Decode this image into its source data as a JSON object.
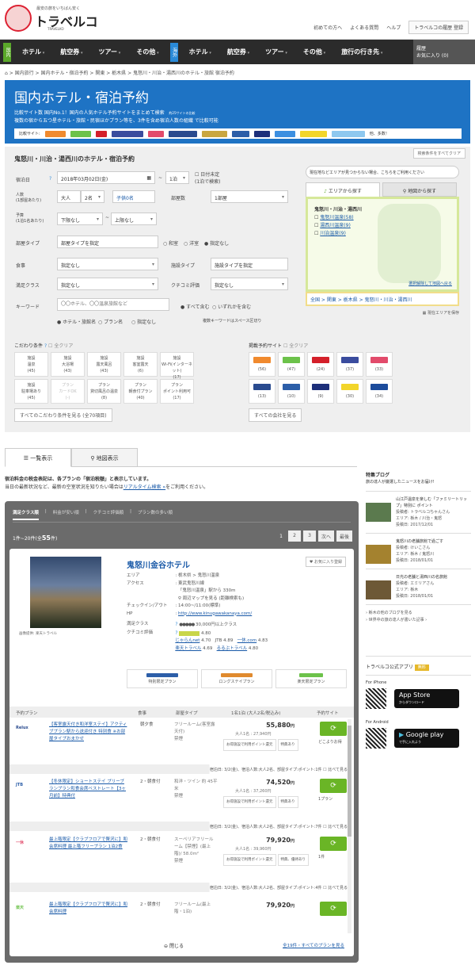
{
  "header": {
    "logo": "トラベルコ",
    "logo_tagline": "最安の旅をいちばん安く",
    "logo_sub": "TRAVELKO",
    "links": [
      "初めての方へ",
      "よくある質問",
      "ヘルプ"
    ],
    "history_button": "トラベルコの履歴 登録"
  },
  "nav": {
    "domestic_tag": "国内",
    "overseas_tag": "海外",
    "domestic": [
      "ホテル",
      "航空券",
      "ツアー",
      "その他"
    ],
    "overseas": [
      "ホテル",
      "航空券",
      "ツアー",
      "その他",
      "旅行の行き先"
    ],
    "history": "履歴",
    "favorites": "お気に入り (0)"
  },
  "breadcrumb": "⌂ > 国内旅行 > 国内ホテル・宿泊予約 > 関東 > 栃木県 > 鬼怒川・川治・湯西川のホテル・旅館 宿泊予約",
  "banner": {
    "title": "国内ホテル・宿泊予約",
    "line1": "比較サイト数 国内No.1！国内の人気ホテル予約サイトをまとめて検索",
    "line1_note": "約25サイトの比較",
    "line2": "複数の宿から五つ星ホテル・旅館・民宿ほかプラン等を、3件を含め宿泊人数の組織 で比較可能",
    "sites_label": "比較サイト:",
    "sites_more": "他、多数！"
  },
  "search": {
    "title": "鬼怒川・川治・湯西川のホテル・宿泊予約",
    "clear": "検索条件をすべてクリア",
    "date_label": "宿泊日",
    "date": "2018年03月02日(金)",
    "nights": "1泊",
    "undecided": "日付未定",
    "undecided_note": "(1泊で検索)",
    "people_label": "人数",
    "people_sub": "(1部屋あたり)",
    "adult": "大人",
    "adult_count": "2名",
    "children": "子供0名",
    "rooms_label": "部屋数",
    "rooms": "1部屋",
    "budget_label": "予算",
    "budget_sub": "(1泊1名あたり)",
    "budget_min": "下限なし",
    "budget_max": "上限なし",
    "roomtype_label": "部屋タイプ",
    "roomtype": "部屋タイプを指定",
    "room_opts": [
      "和室",
      "洋室",
      "指定なし"
    ],
    "meal_label": "食事",
    "meal": "指定なし",
    "facility_label": "施設タイプ",
    "facility": "施設タイプを指定",
    "class_label": "満足クラス",
    "class": "指定なし",
    "rating_label": "クチコミ評価",
    "rating": "指定なし",
    "keyword_label": "キーワード",
    "keyword_placeholder": "〇〇ホテル、〇〇温泉旅館など",
    "kw_opts": [
      "すべて含む",
      "いずれかを含む"
    ],
    "target_opts": [
      "ホテル・旅館名",
      "プラン名",
      "指定なし"
    ],
    "kw_note": "複数キーワードはスペース区切り",
    "area_hint": "現在地などエリアが見つからない場合、こちらをご利用ください",
    "area_tab": "エリアから探す",
    "map_tab": "地図から探す",
    "area_title": "鬼怒川・川治・湯西川",
    "areas": [
      "鬼怒川温泉(58)",
      "湯西川温泉(9)",
      "川治温泉(9)"
    ],
    "area_back": "選択解除して地図へ戻る",
    "area_path": "全国 > 関東 > 栃木県 > 鬼怒川・川治・湯西川",
    "area_save": "現在エリアを保存"
  },
  "conditions": {
    "title": "こだわり条件",
    "clear": "全クリア",
    "items": [
      [
        "施設",
        "温泉",
        "(45)"
      ],
      [
        "施設",
        "大浴場",
        "(43)"
      ],
      [
        "施設",
        "露天風呂",
        "(43)"
      ],
      [
        "施設",
        "客室露天",
        "(6)"
      ],
      [
        "施設",
        "Wi-Fi(インターネット)",
        "(17)"
      ],
      [
        "施設",
        "駐車場あり",
        "(45)"
      ],
      [
        "プラン",
        "カードOK",
        "(-)"
      ],
      [
        "プラン",
        "貸切風呂の温泉",
        "(8)"
      ],
      [
        "プラン",
        "朝食付プラン",
        "(40)"
      ],
      [
        "プラン",
        "ポイント利用可",
        "(17)"
      ]
    ],
    "more": "すべてのこだわり条件を見る (全70項目)"
  },
  "sites": {
    "title": "掲載予約サイト",
    "clear": "全クリア",
    "items": [
      [
        "jalan",
        "#f08a2e",
        "(56)"
      ],
      [
        "楽天",
        "#6cc24a",
        "(47)"
      ],
      [
        "JTB",
        "#d4202a",
        "(24)"
      ],
      [
        "るるぶ",
        "#3a4c9e",
        "(37)"
      ],
      [
        "一休",
        "#e24b6b",
        "(33)"
      ],
      [
        "Relux",
        "#2a4b8f",
        "(13)"
      ],
      [
        "JAL",
        "#2c5ea8",
        "(10)"
      ],
      [
        "ANA",
        "#1d2f7a",
        "(9)"
      ],
      [
        "Yahoo",
        "#f2d52a",
        "(30)"
      ],
      [
        "Booking",
        "#1c4c9c",
        "(34)"
      ]
    ],
    "more": "すべての会社を見る"
  },
  "view_tabs": [
    "一覧表示",
    "地図表示"
  ],
  "notice": {
    "line1": "宿泊料金の税金表記は、各プランの「宿泊税額」と表示しています。",
    "line2": "当日の最新状況など、最新の空室状況を知りたい場合は",
    "link": "リアルタイム検索 »",
    "line2_end": "をご利用ください。"
  },
  "results": {
    "sorts": [
      "満足クラス順",
      "料金が安い順",
      "クチコミ評価順",
      "プラン数の多い順"
    ],
    "count_prefix": "1件~20件(全",
    "count": "55",
    "count_suffix": "件)",
    "pages": [
      "1",
      "2",
      "3",
      "次へ",
      "最後"
    ],
    "hotel": {
      "name": "鬼怒川金谷ホテル",
      "favorite": "お気に入り登録",
      "photo_credit": "画像提供: 楽天トラベル",
      "area_label": "エリア",
      "area": "栃木県 > 鬼怒川温泉",
      "access_label": "アクセス",
      "access": "東武鬼怒川線",
      "access2": "「鬼怒川温泉」駅から 330m",
      "map_link": "周辺マップを見る (距離検索も)",
      "checkin_label": "チェックイン/アウト",
      "checkin": "14:00~/11:00(標準)",
      "hp_label": "HP",
      "hp": "http://www.kinugawakanaya.com/",
      "class_label": "満足クラス",
      "class": "30,000円以上クラス",
      "rating_label": "クチコミ評価",
      "rating": "4.80",
      "reviews": [
        [
          "じゃらんnet",
          "4.70",
          "JTB",
          "4.89"
        ],
        [
          "楽天トラベル",
          "4.69",
          "るるぶトラベル",
          "4.80"
        ]
      ],
      "rev_extra": [
        "一休.com",
        "4.83"
      ],
      "plan_buttons": [
        "特別限定プラン",
        "ロングステイプラン",
        "楽天限定プラン"
      ]
    },
    "table_headers": [
      "予約プラン",
      "食事",
      "部屋タイプ",
      "1名1泊 (大人2名/税込み)",
      "予約サイト"
    ],
    "plans": [
      {
        "site": "Relux",
        "color": "#2a4b8f",
        "name": "【客室露天付き和洋室ステイ】アクティブプラン駅から送迎付き 特別食 ※お部屋タイプおまかせ",
        "meal": "朝夕食",
        "room": "フリールーム(客室露天付)",
        "room_note": "禁煙",
        "price": "55,880",
        "unit": "円",
        "sub": "大人1名 : 27,940円",
        "tags": [
          "お得施設で利用ポイント還元",
          "特典あり"
        ],
        "go_sub": "どこよりお得",
        "footer": "宿泊日: 3/2(金)、宿泊人数:大人2名、部屋タイプ:ポイント:1件  ☐ 比べて見る"
      },
      {
        "site": "JTB",
        "color": "#2c5ea8",
        "name": "【冬休限定】ショートステイ プリーブランプラン和食会席ベストレート【3ヶ月前】特典付",
        "meal": "2・朝食付",
        "room": "和洋・ツイン 約 45平米",
        "room_note": "禁煙",
        "price": "74,520",
        "unit": "円",
        "sub": "大人1名 : 37,260円",
        "tags": [
          "お得施設で利用ポイント還元",
          "特典あり"
        ],
        "go_sub": "1プラン",
        "footer": "宿泊日: 3/2(金)、宿泊人数:大人2名、部屋タイプ:ポイント:7件  ☐ 比べて見る"
      },
      {
        "site": "一休",
        "color": "#e24b6b",
        "name": "最上階限定【クラブフロアで贅沢に】和会席料理 最上階フリープラン 1泊2食",
        "meal": "2・朝食付",
        "room": "スーペリアフリールーム【禁煙】(最上階)/ 58.0m²",
        "room_note": "禁煙",
        "price": "79,920",
        "unit": "円",
        "sub": "大人1名 : 39,960円",
        "tags": [
          "お得施設で利用ポイント還元",
          "特典、優待あり"
        ],
        "go_sub": "1件",
        "footer": "宿泊日: 3/2(金)、宿泊人数:大人2名、部屋タイプ:ポイント:4件  ☐ 比べて見る"
      },
      {
        "site": "楽天",
        "color": "#6cc24a",
        "name": "最上階限定【クラブフロアで贅沢に】和会席料理",
        "meal": "2・朝食付",
        "room": "フリールーム(最上階・1泊)",
        "room_note": "",
        "price": "79,920",
        "unit": "円",
        "sub": "",
        "tags": [],
        "go_sub": "",
        "footer": ""
      }
    ],
    "close": "閉じる",
    "all_plans": "全19件・すべてのプランを見る"
  },
  "sidebar": {
    "title": "特集ブログ",
    "subtitle": "旅の達人が厳選したニュースをお届け!",
    "articles": [
      {
        "title": "山江戸温泉を楽しむ「ファミリートリップ」特別に ポイント",
        "author": "投稿者: トラベルコちゃんさん",
        "area": "エリア: 栃木 / 川治・鬼怒",
        "date": "投稿日: 2017/12/01",
        "color": "#5b7a4e"
      },
      {
        "title": "鬼怒川の老舗旅館で過ごす",
        "author": "投稿者: けいこさん",
        "area": "エリア: 栃木 / 鬼怒川",
        "date": "投稿日: 2018/01/01",
        "color": "#a4822f"
      },
      {
        "title": "日光の老舗と湯西川の名旅館",
        "author": "投稿者: エミリアさん",
        "area": "エリア: 栃木",
        "date": "投稿日: 2018/01/01",
        "color": "#6d5836"
      }
    ],
    "links": [
      "› 栃木の他のブログを見る",
      "› 世界中の旅の達人が書いた記事 ›"
    ],
    "app_title": "トラベルコ公式アプリ",
    "app_badge": "無料",
    "iphone": "For iPhone",
    "appstore": "App Store",
    "appstore_sub": "からダウンロード",
    "android": "For Android",
    "gplay": "Google play",
    "gplay_sub": "で手に入れよう"
  }
}
